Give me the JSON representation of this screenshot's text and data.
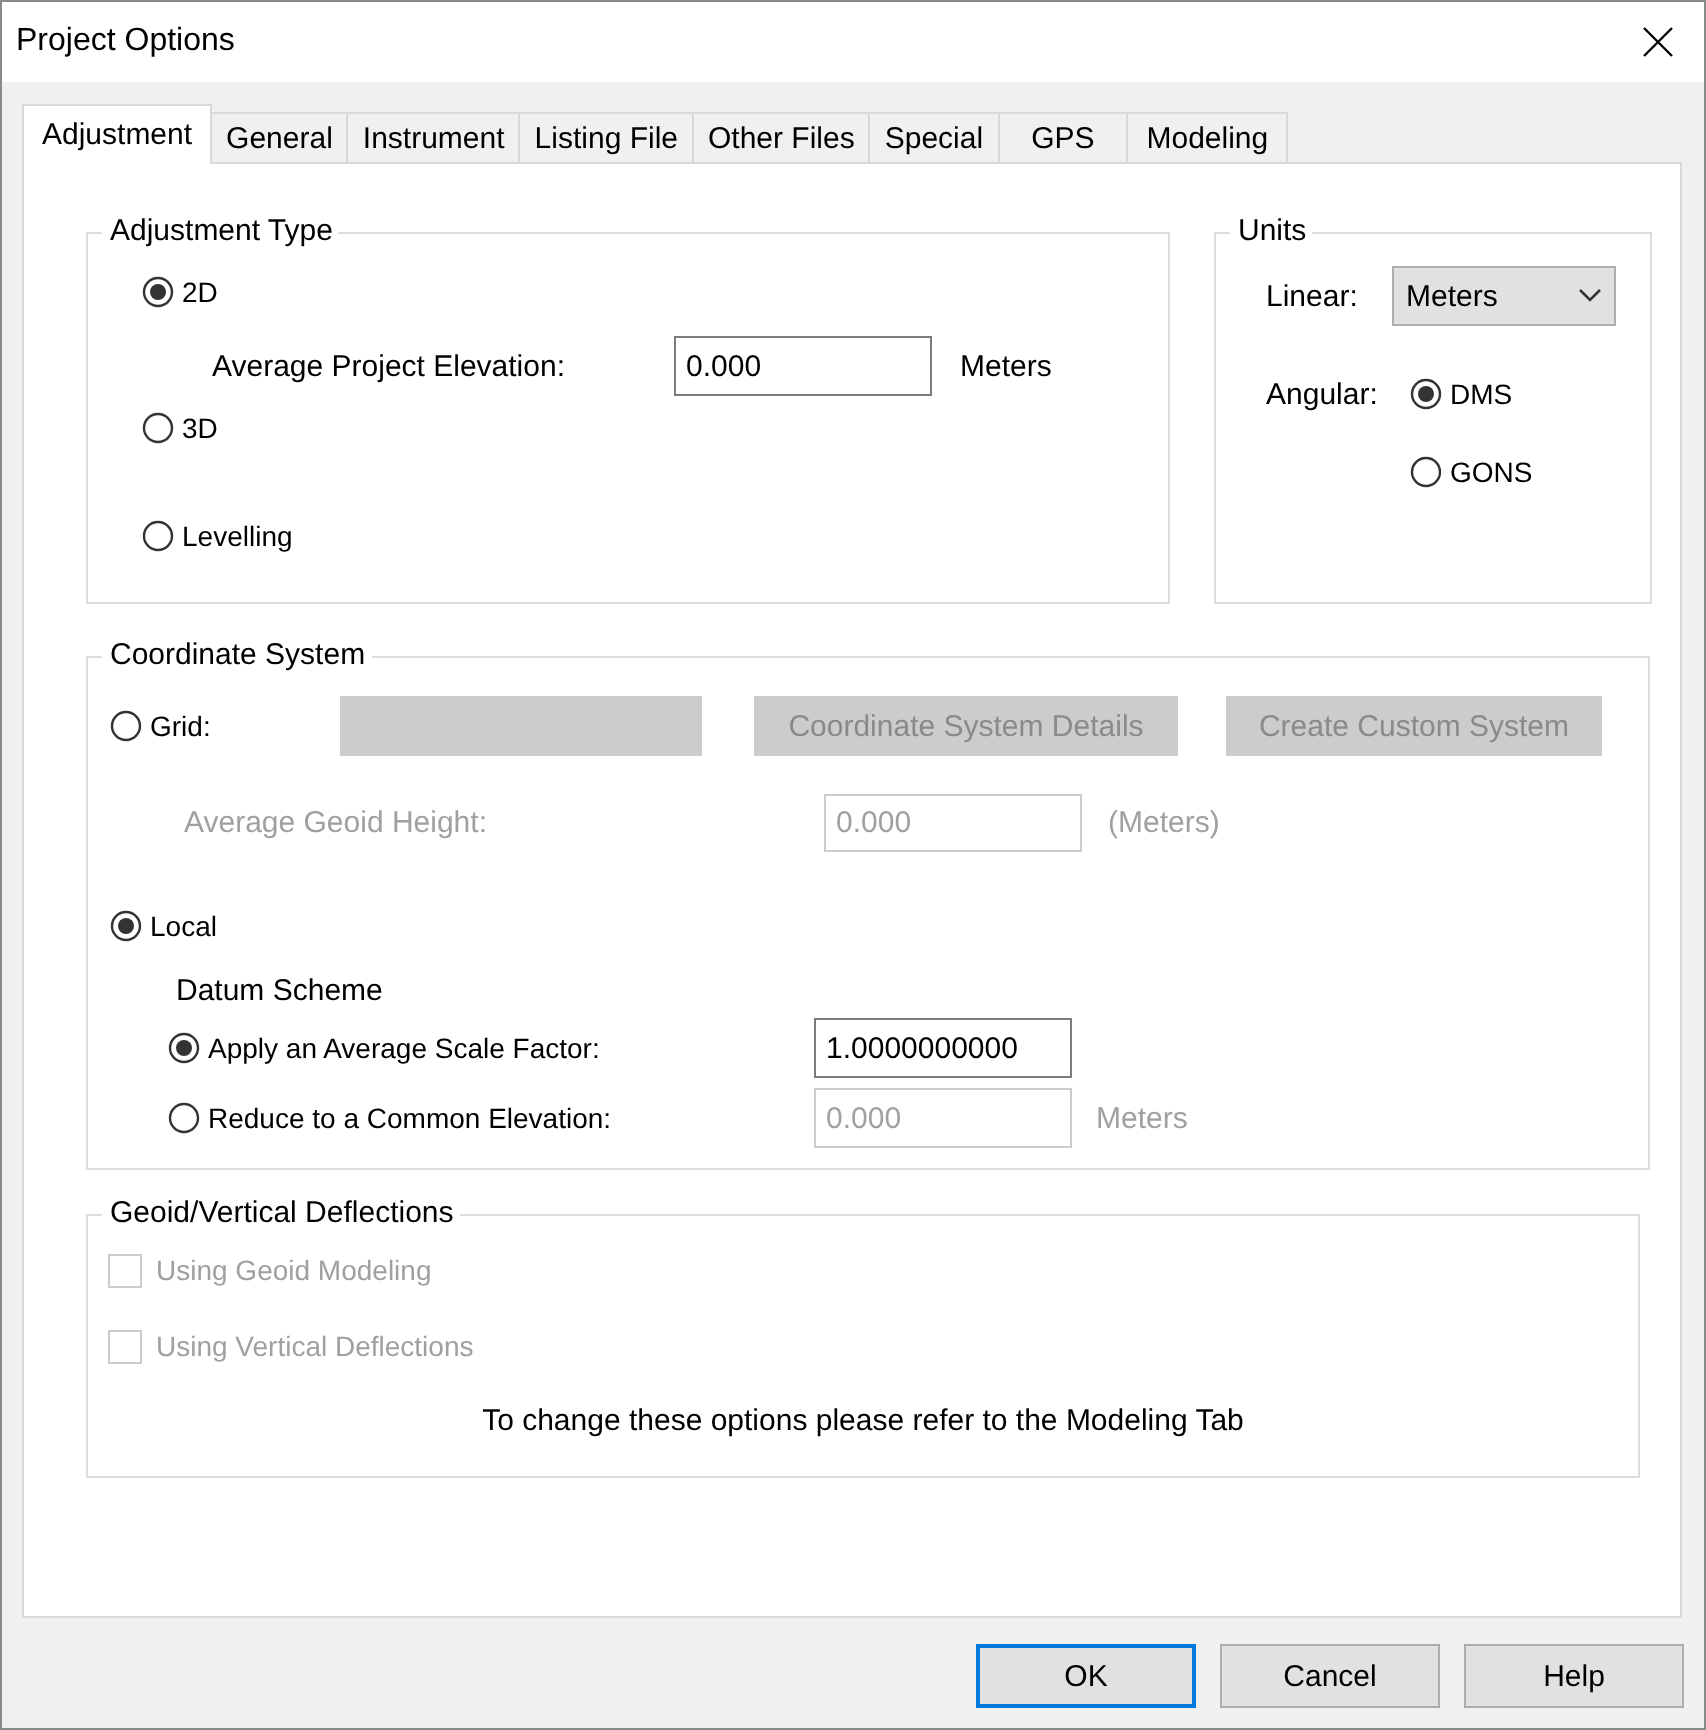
{
  "window": {
    "title": "Project Options"
  },
  "tabs": [
    {
      "label": "Adjustment",
      "selected": true
    },
    {
      "label": "General",
      "selected": false
    },
    {
      "label": "Instrument",
      "selected": false
    },
    {
      "label": "Listing File",
      "selected": false
    },
    {
      "label": "Other Files",
      "selected": false
    },
    {
      "label": "Special",
      "selected": false
    },
    {
      "label": "GPS",
      "selected": false
    },
    {
      "label": "Modeling",
      "selected": false
    }
  ],
  "adjustment_type": {
    "title": "Adjustment Type",
    "options": [
      {
        "label": "2D",
        "selected": true
      },
      {
        "label": "3D",
        "selected": false
      },
      {
        "label": "Levelling",
        "selected": false
      }
    ],
    "elevation": {
      "label": "Average Project Elevation:",
      "value": "0.000",
      "unit": "Meters"
    }
  },
  "units": {
    "title": "Units",
    "linear": {
      "label": "Linear:",
      "value": "Meters"
    },
    "angular": {
      "label": "Angular:",
      "options": [
        {
          "label": "DMS",
          "selected": true
        },
        {
          "label": "GONS",
          "selected": false
        }
      ]
    }
  },
  "coordinate_system": {
    "title": "Coordinate System",
    "grid": {
      "label": "Grid:",
      "selected": false
    },
    "system_field": {
      "disabled": true
    },
    "buttons": [
      {
        "label": "Coordinate System Details",
        "disabled": true
      },
      {
        "label": "Create Custom System",
        "disabled": true
      }
    ],
    "geoid_height": {
      "label": "Average Geoid Height:",
      "value": "0.000",
      "unit": "(Meters)",
      "disabled": true
    },
    "local": {
      "label": "Local",
      "selected": true
    },
    "datum_scheme": {
      "title": "Datum Scheme",
      "options": [
        {
          "label": "Apply an Average Scale Factor:",
          "selected": true,
          "value": "1.0000000000",
          "disabled": false
        },
        {
          "label": "Reduce to a Common Elevation:",
          "selected": false,
          "value": "0.000",
          "unit": "Meters",
          "disabled": true
        }
      ]
    }
  },
  "geoid_deflections": {
    "title": "Geoid/Vertical Deflections",
    "checks": [
      {
        "label": "Using Geoid Modeling",
        "checked": false,
        "disabled": true
      },
      {
        "label": "Using Vertical Deflections",
        "checked": false,
        "disabled": true
      }
    ],
    "note": "To change these options please refer to the Modeling Tab"
  },
  "footer_buttons": [
    {
      "label": "OK",
      "default": true
    },
    {
      "label": "Cancel",
      "default": false
    },
    {
      "label": "Help",
      "default": false
    }
  ]
}
